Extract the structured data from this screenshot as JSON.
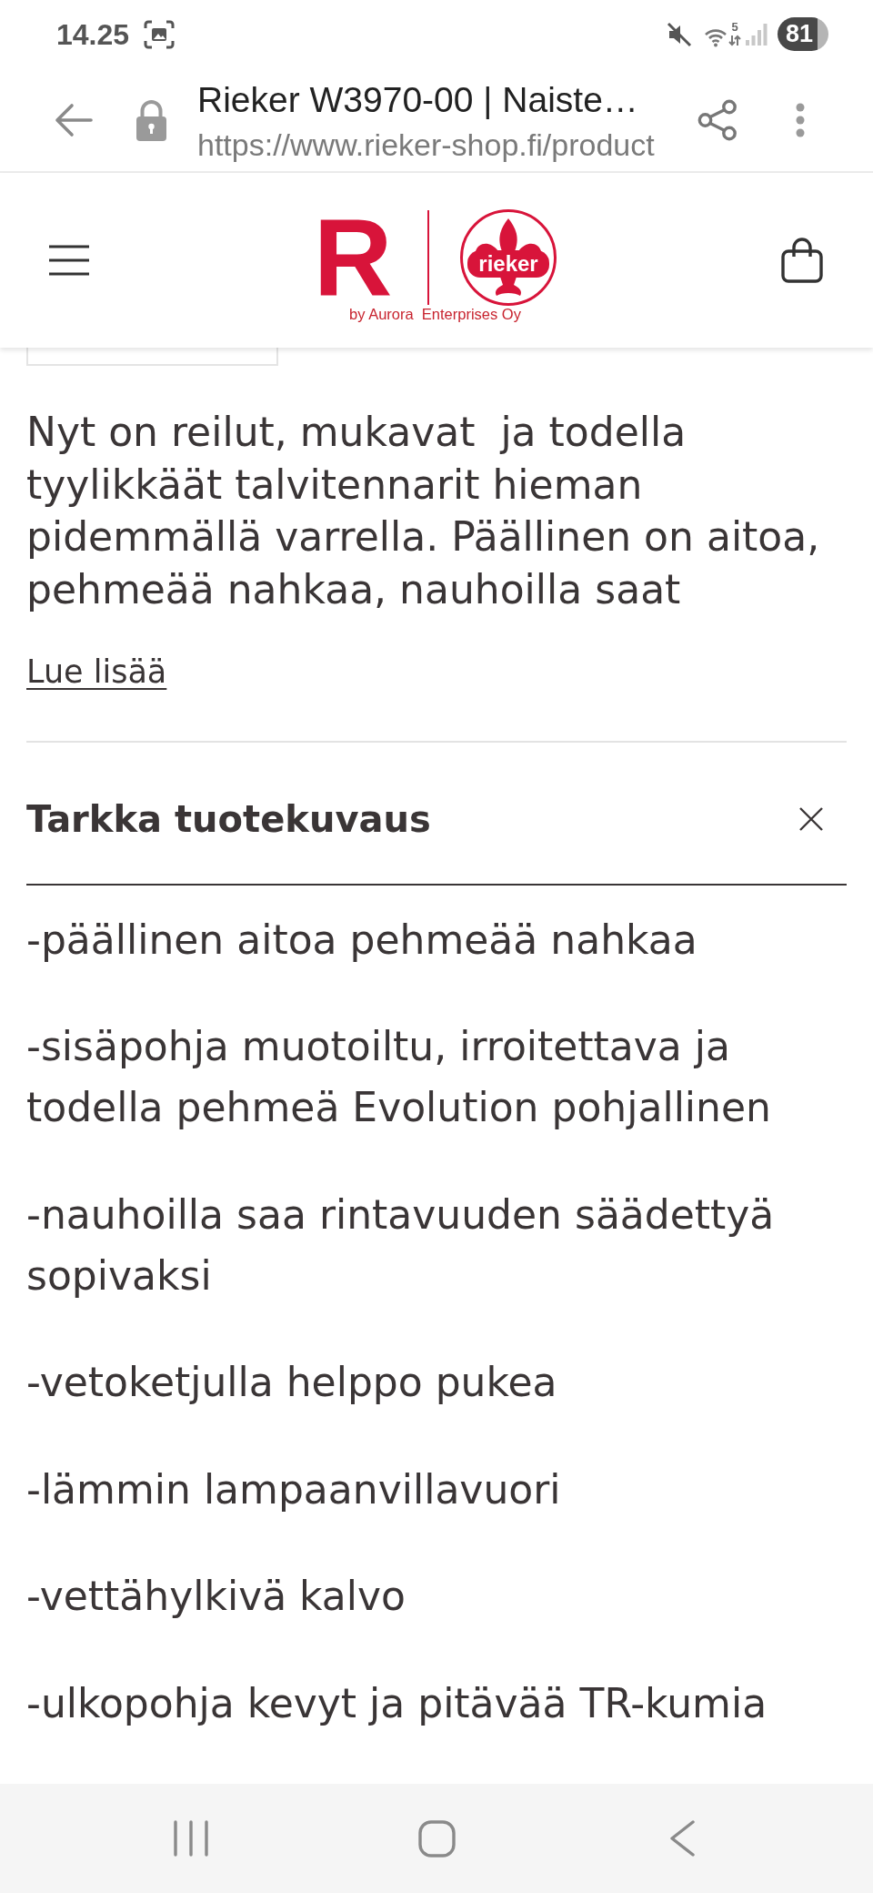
{
  "status_bar": {
    "time": "14.25",
    "wifi_band": "5",
    "battery": "81"
  },
  "browser": {
    "title": "Rieker W3970-00 | Naiste…",
    "url": "https://www.rieker-shop.fi/product"
  },
  "header": {
    "logo": {
      "letter": "R",
      "wordmark": "rieker",
      "tagline": "by Aurora  Enterprises Oy"
    }
  },
  "description": {
    "lines": [
      "Nyt on reilut, mukavat  ja todella",
      "tyylikkäät talvitennarit hieman",
      "pidemmällä varrella. Päällinen on aitoa,",
      "pehmeää nahkaa, nauhoilla saat"
    ],
    "link": "Lue lisää"
  },
  "details": {
    "title": "Tarkka tuotekuvaus",
    "expanded": true,
    "items": [
      "-päällinen aitoa pehmeää nahkaa",
      "-sisäpohja muotoiltu, irroitettava ja todella pehmeä Evolution pohjallinen",
      "-nauhoilla saa rintavuuden säädettyä sopivaksi",
      "-vetoketjulla helppo pukea",
      "-lämmin lampaanvillavuori",
      "-vettähylkivä kalvo",
      "-ulkopohja kevyt ja pitävää TR-kumia"
    ]
  }
}
